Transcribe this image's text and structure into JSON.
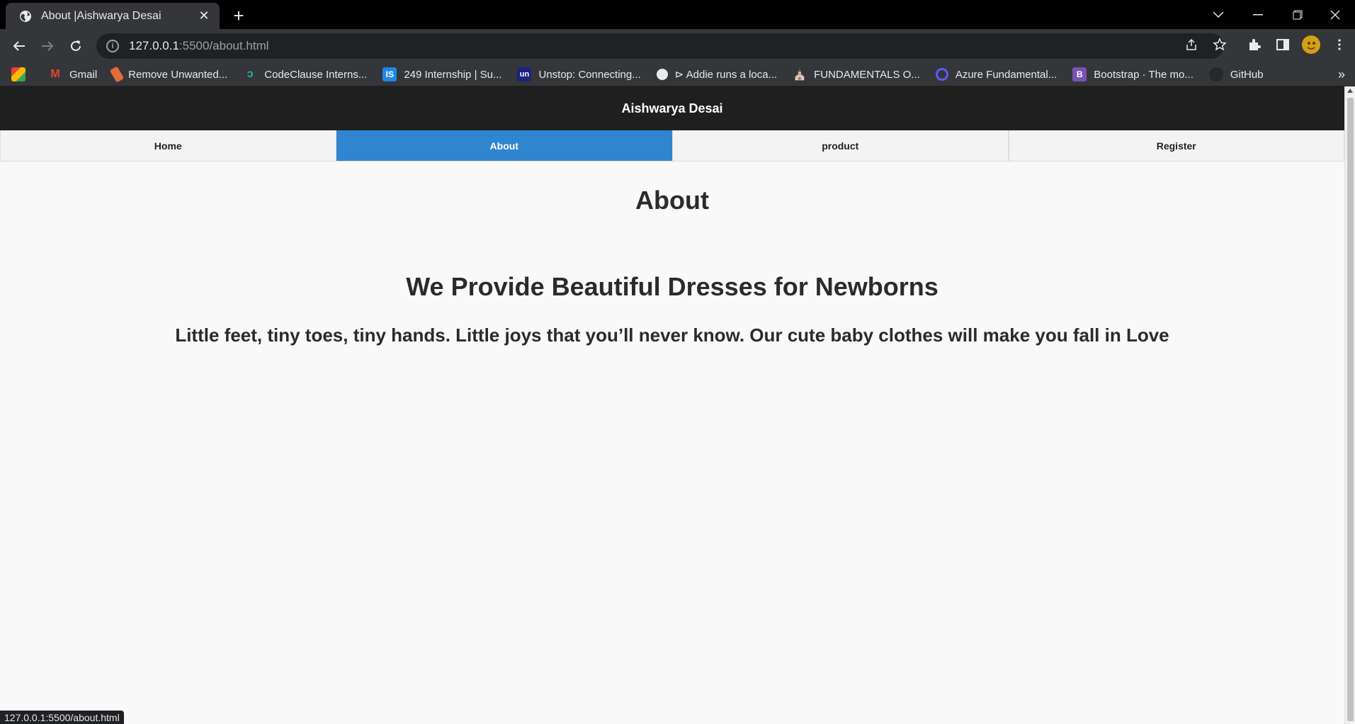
{
  "browser": {
    "tab_title": "About |Aishwarya Desai",
    "url_host": "127.0.0.1",
    "url_rest": ":5500/about.html",
    "status_text": "127.0.0.1:5500/about.html",
    "bookmarks": [
      {
        "label": "",
        "icon": "apps-icon",
        "color": "#f4b400"
      },
      {
        "label": "Gmail",
        "icon": "gmail-icon",
        "color": "#ea4335"
      },
      {
        "label": "Remove Unwanted...",
        "icon": "eraser-icon",
        "color": "#e46c3b"
      },
      {
        "label": "CodeClause Interns...",
        "icon": "codeclause-icon",
        "color": "#20b2aa"
      },
      {
        "label": "249 Internship | Su...",
        "icon": "is-icon",
        "color": "#1e88e5"
      },
      {
        "label": "Unstop: Connecting...",
        "icon": "unstop-icon",
        "color": "#1a237e"
      },
      {
        "label": "⊳ Addie runs a loca...",
        "icon": "globe-icon",
        "color": "#5f6368"
      },
      {
        "label": "FUNDAMENTALS O...",
        "icon": "building-icon",
        "color": "#c77800"
      },
      {
        "label": "Azure Fundamental...",
        "icon": "q-icon",
        "color": "#5b5bff"
      },
      {
        "label": "Bootstrap · The mo...",
        "icon": "bootstrap-icon",
        "color": "#7952b3"
      },
      {
        "label": "GitHub",
        "icon": "github-icon",
        "color": "#24292e"
      }
    ]
  },
  "site": {
    "brand": "Aishwarya Desai",
    "nav": [
      {
        "label": "Home",
        "active": false
      },
      {
        "label": "About",
        "active": true
      },
      {
        "label": "product",
        "active": false
      },
      {
        "label": "Register",
        "active": false
      }
    ],
    "page_title": "About",
    "headline": "We Provide Beautiful Dresses for Newborns",
    "tagline": "Little feet, tiny toes, tiny hands. Little joys that you’ll never know. Our cute baby clothes will make you fall in Love",
    "accent_color": "#3085cf"
  }
}
